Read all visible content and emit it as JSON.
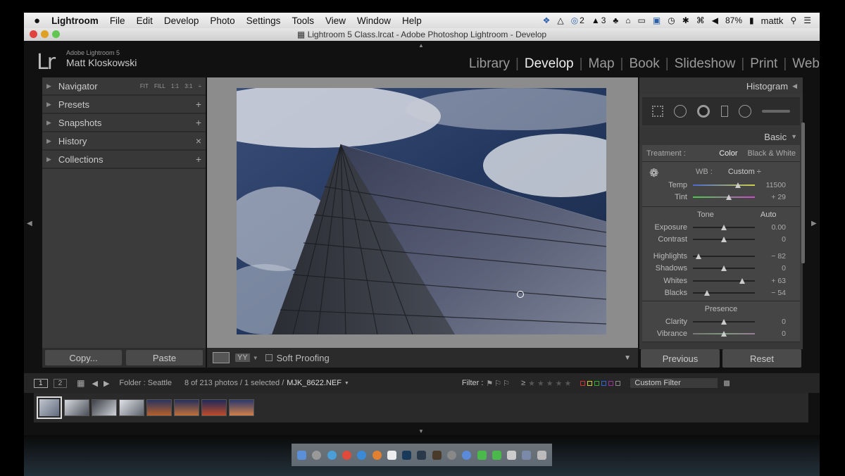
{
  "menubar": {
    "apple": "",
    "app": "Lightroom",
    "items": [
      "File",
      "Edit",
      "Develop",
      "Photo",
      "Settings",
      "Tools",
      "View",
      "Window",
      "Help"
    ],
    "status": {
      "cc_count": "2",
      "adobe_count": "3",
      "battery": "87%",
      "user": "mattk"
    }
  },
  "window": {
    "title": "Lightroom 5 Class.lrcat - Adobe Photoshop Lightroom - Develop"
  },
  "identity": {
    "logo": "Lr",
    "product": "Adobe Lightroom 5",
    "name": "Matt Kloskowski"
  },
  "modules": [
    "Library",
    "Develop",
    "Map",
    "Book",
    "Slideshow",
    "Print",
    "Web"
  ],
  "left_panel": {
    "navigator": "Navigator",
    "nav_options": "FIT FILL 1:1 3:1 ÷",
    "presets": "Presets",
    "snapshots": "Snapshots",
    "history": "History",
    "collections": "Collections",
    "add": "+",
    "clear": "×",
    "copy": "Copy...",
    "paste": "Paste"
  },
  "toolbar": {
    "view_mode": "YY",
    "soft_proofing": "Soft Proofing"
  },
  "right_panel": {
    "histogram": "Histogram",
    "basic": "Basic",
    "treatment_label": "Treatment :",
    "treatment_color": "Color",
    "treatment_bw": "Black & White",
    "wb_label": "WB :",
    "wb_value": "Custom ÷",
    "sliders_wb": [
      {
        "label": "Temp",
        "value": "11500",
        "pos": 0.73
      },
      {
        "label": "Tint",
        "value": "+ 29",
        "pos": 0.58
      }
    ],
    "tone": "Tone",
    "auto": "Auto",
    "sliders_tone": [
      {
        "label": "Exposure",
        "value": "0.00",
        "pos": 0.5
      },
      {
        "label": "Contrast",
        "value": "0",
        "pos": 0.5
      }
    ],
    "sliders_tone2": [
      {
        "label": "Highlights",
        "value": "− 82",
        "pos": 0.09
      },
      {
        "label": "Shadows",
        "value": "0",
        "pos": 0.5
      },
      {
        "label": "Whites",
        "value": "+ 63",
        "pos": 0.8
      },
      {
        "label": "Blacks",
        "value": "− 54",
        "pos": 0.23
      }
    ],
    "presence": "Presence",
    "sliders_presence": [
      {
        "label": "Clarity",
        "value": "0",
        "pos": 0.5
      },
      {
        "label": "Vibrance",
        "value": "0",
        "pos": 0.5
      }
    ],
    "previous": "Previous",
    "reset": "Reset"
  },
  "filmstrip": {
    "page1": "1",
    "page2": "2",
    "folder": "Folder : Seattle",
    "count": "8 of 213 photos / 1 selected /",
    "file": "MJK_8622.NEF",
    "filter_label": "Filter :",
    "rating_op": "≥",
    "custom_filter": "Custom Filter"
  },
  "colors": {
    "accent": "#4a7fbf",
    "bg": "#383838"
  }
}
